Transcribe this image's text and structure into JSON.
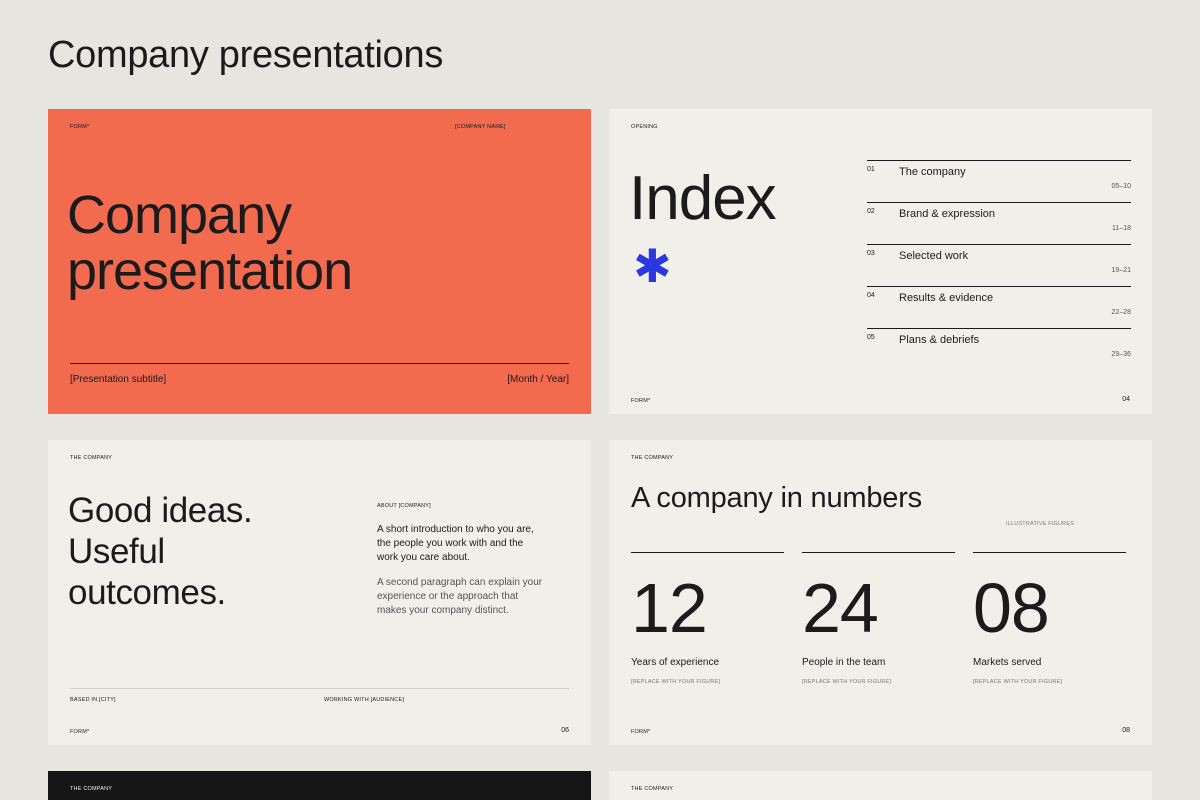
{
  "page": {
    "title": "Company presentations"
  },
  "slides": {
    "cover": {
      "brand": "FORM*",
      "company_name": "[COMPANY NAME]",
      "title_line1": "Company",
      "title_line2": "presentation",
      "subtitle": "[Presentation subtitle]",
      "date": "[Month / Year]",
      "background": "#f26b4f"
    },
    "index": {
      "section": "OPENING",
      "title": "Index",
      "accent_symbol": "✱",
      "accent_color": "#2b37e0",
      "items": [
        {
          "num": "01",
          "label": "The company",
          "pages": "05–10"
        },
        {
          "num": "02",
          "label": "Brand & expression",
          "pages": "11–18"
        },
        {
          "num": "03",
          "label": "Selected work",
          "pages": "19–21"
        },
        {
          "num": "04",
          "label": "Results & evidence",
          "pages": "22–28"
        },
        {
          "num": "05",
          "label": "Plans & debriefs",
          "pages": "29–36"
        }
      ],
      "brand": "FORM*",
      "page_number": "04"
    },
    "about": {
      "section": "THE COMPANY",
      "headline_line1": "Good ideas.",
      "headline_line2": "Useful",
      "headline_line3": "outcomes.",
      "about_label": "ABOUT [COMPANY]",
      "para1": "A short introduction to who you are, the people you work with and the work you care about.",
      "para2": "A second paragraph can explain your experience or the approach that makes your company distinct.",
      "based_in": "BASED IN [CITY]",
      "working_with": "WORKING WITH [AUDIENCE]",
      "brand": "FORM*",
      "page_number": "06"
    },
    "numbers": {
      "section": "THE COMPANY",
      "title": "A company in numbers",
      "figures_note": "ILLUSTRATIVE FIGURES",
      "stats": [
        {
          "value": "12",
          "label": "Years of experience",
          "note": "[REPLACE WITH YOUR FIGURE]"
        },
        {
          "value": "24",
          "label": "People in the team",
          "note": "[REPLACE WITH YOUR FIGURE]"
        },
        {
          "value": "08",
          "label": "Markets served",
          "note": "[REPLACE WITH YOUR FIGURE]"
        }
      ],
      "brand": "FORM*",
      "page_number": "08"
    },
    "dark_peek": {
      "section": "THE COMPANY"
    },
    "light_peek": {
      "section": "THE COMPANY"
    }
  }
}
